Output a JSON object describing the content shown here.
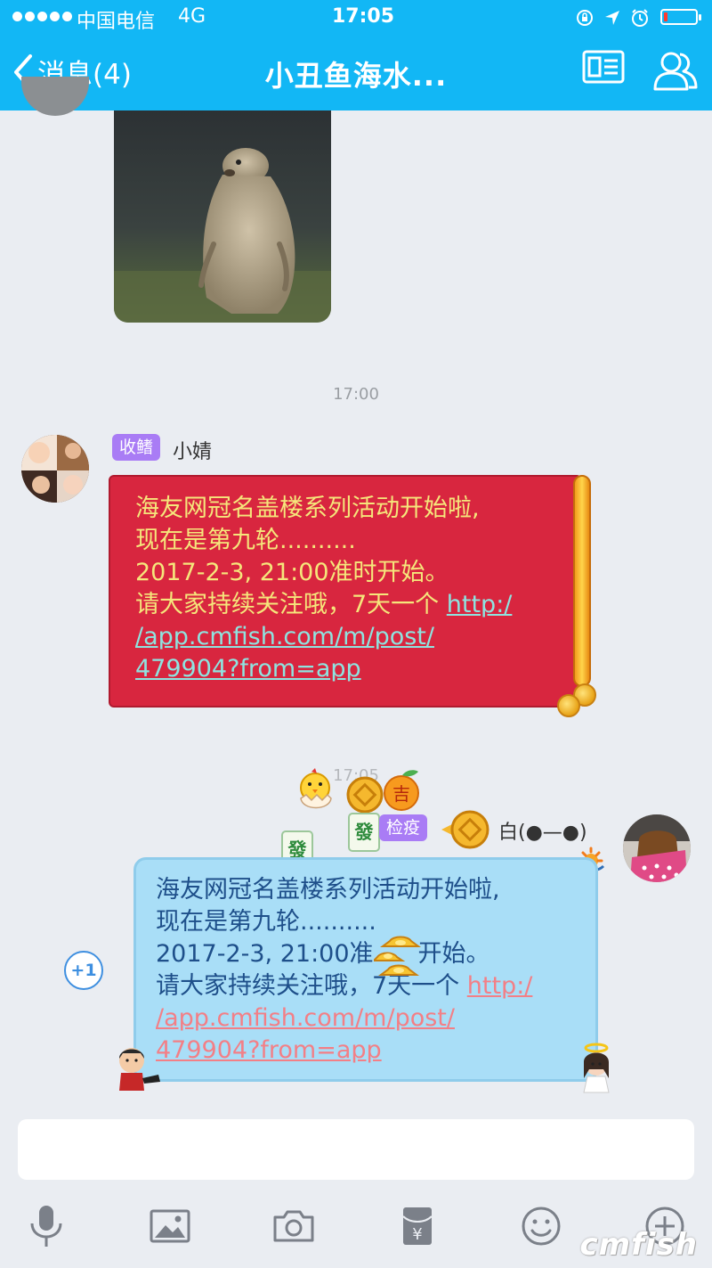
{
  "status_bar": {
    "carrier": "中国电信",
    "network": "4G",
    "time": "17:05",
    "battery_level": 0.12,
    "battery_color": "#FF3B30"
  },
  "nav": {
    "back_label": "消息(4)",
    "title": "小丑鱼海水...",
    "icons": [
      "chevron-left-icon",
      "profile-card-icon",
      "group-members-icon"
    ]
  },
  "colors": {
    "nav_bg": "#12B7F5",
    "chat_bg": "#EAEDF2",
    "badge": "#A97CF5",
    "red_bubble": "#D8263F",
    "blue_bubble": "#A9DEF7"
  },
  "messages": [
    {
      "kind": "image",
      "side": "left",
      "description_icon": "marmot-photo"
    },
    {
      "kind": "timestamp",
      "text": "17:00"
    },
    {
      "kind": "text",
      "side": "left",
      "badge": "收鳍",
      "sender": "小婧",
      "lines": [
        "海友网冠名盖楼系列活动开始啦,",
        "现在是第九轮..........",
        "2017-2-3, 21:00准时开始。",
        "请大家持续关注哦，7天一个 "
      ],
      "link_parts": [
        "http:/",
        "/app.cmfish.com/m/post/",
        "479904?from=app"
      ]
    },
    {
      "kind": "timestamp",
      "text": "17:05"
    },
    {
      "kind": "text",
      "side": "right",
      "badge": "检疫",
      "tile": "發",
      "sender": "白(●—●)",
      "lines": [
        "海友网冠名盖楼系列活动开始啦,",
        "现在是第九轮..........",
        "2017-2-3, 21:00准",
        "开始。",
        "请大家持续关注哦，7天一个 "
      ],
      "link_parts": [
        "http:/",
        "/app.cmfish.com/m/post/",
        "479904?from=app"
      ],
      "plus_one": "+1"
    }
  ],
  "composer": {
    "input_value": "",
    "toolbar_icons": [
      "microphone-icon",
      "image-icon",
      "camera-icon",
      "red-packet-icon",
      "emoji-icon",
      "plus-icon"
    ],
    "red_packet_symbol": "¥"
  },
  "watermark": "cmfish"
}
